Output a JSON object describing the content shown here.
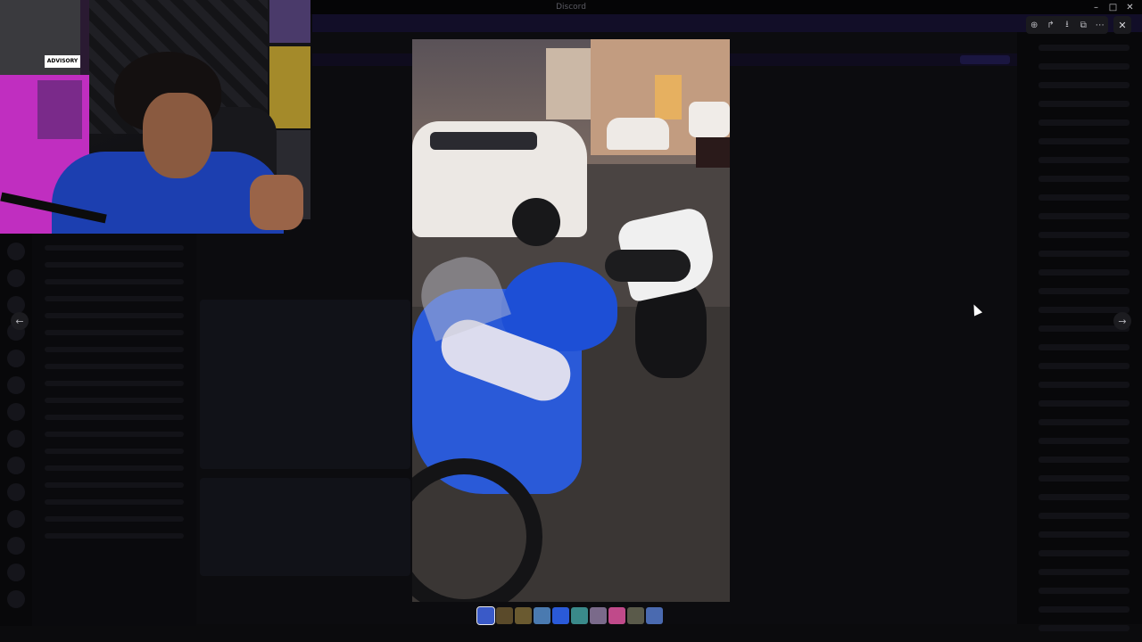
{
  "window": {
    "title": "Discord",
    "controls": {
      "minimize": "–",
      "maximize": "□",
      "close": "✕"
    }
  },
  "viewer": {
    "toolbar": [
      {
        "name": "zoom-icon",
        "glyph": "⊕"
      },
      {
        "name": "forward-icon",
        "glyph": "↱"
      },
      {
        "name": "download-icon",
        "glyph": "⭳"
      },
      {
        "name": "open-external-icon",
        "glyph": "⧉"
      },
      {
        "name": "more-icon",
        "glyph": "⋯"
      }
    ],
    "close_glyph": "✕",
    "prev_glyph": "←",
    "next_glyph": "→"
  },
  "thumbnails": {
    "count": 10,
    "active_index": 0,
    "colors": [
      "#3a5ac8",
      "#5a4a2a",
      "#6a5a30",
      "#4a7ab0",
      "#2a5ad8",
      "#3a8a8a",
      "#7a6a8a",
      "#c04a8a",
      "#5a5a4a",
      "#4a6ab0"
    ]
  },
  "webcam": {
    "poster_text": "ADVISORY"
  }
}
